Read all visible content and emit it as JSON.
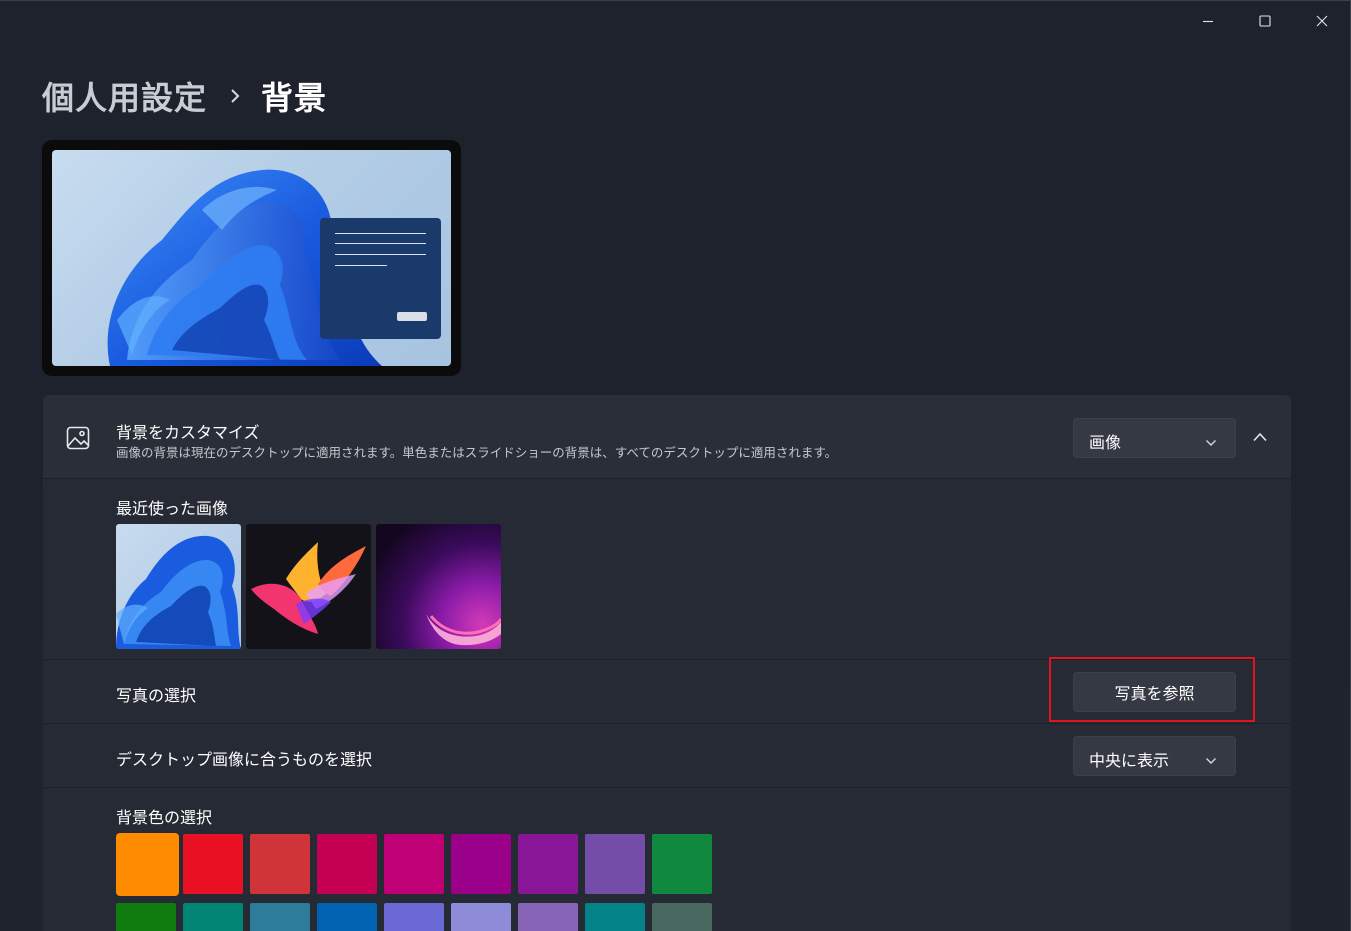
{
  "breadcrumb": {
    "parent": "個人用設定",
    "current": "背景"
  },
  "caption_icons": [
    "minimize-icon",
    "maximize-icon",
    "close-icon"
  ],
  "customize": {
    "title": "背景をカスタマイズ",
    "description": "画像の背景は現在のデスクトップに適用されます。単色またはスライドショーの背景は、すべてのデスクトップに適用されます。",
    "selected": "画像",
    "icon": "image-icon",
    "expanded": true
  },
  "recent": {
    "label": "最近使った画像",
    "images": [
      "bloom-blue",
      "bloom-colorful",
      "purple-glow"
    ]
  },
  "choose_photo": {
    "label": "写真の選択",
    "button": "写真を参照"
  },
  "fit": {
    "label": "デスクトップ画像に合うものを選択",
    "selected": "中央に表示"
  },
  "colors": {
    "label": "背景色の選択",
    "swatches": [
      "#ff8c00",
      "#e81123",
      "#d13438",
      "#c30052",
      "#bf0077",
      "#9a0089",
      "#881798",
      "#744da9",
      "#10893e",
      "#107c10",
      "#018574",
      "#2d7d9a",
      "#0063b1",
      "#6b69d6",
      "#8e8cd8",
      "#8764b8",
      "#038387",
      "#486860"
    ],
    "selected_index": 0
  }
}
